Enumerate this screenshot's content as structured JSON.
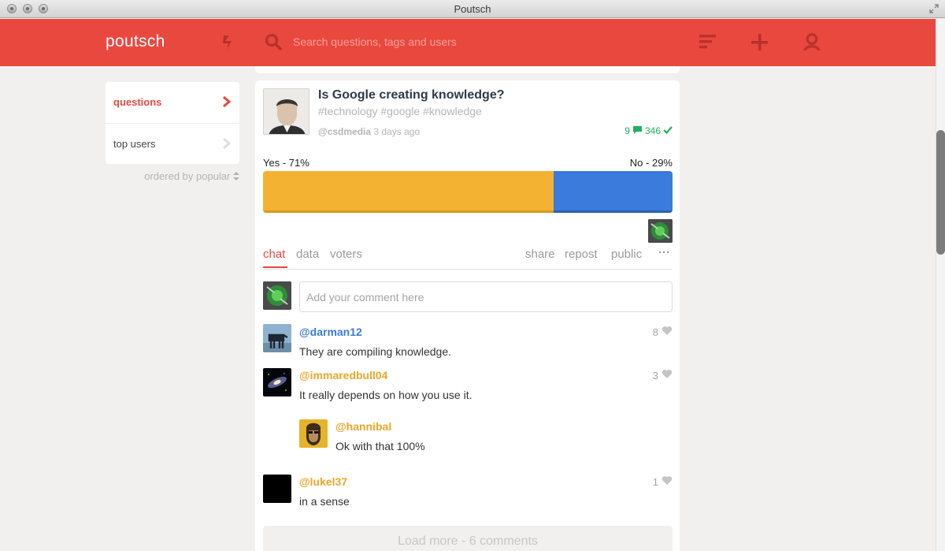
{
  "window": {
    "title": "Poutsch"
  },
  "header": {
    "logo": "poutsch",
    "search_placeholder": "Search questions, tags and users",
    "icons": [
      "bolt-icon",
      "search-icon",
      "menu-icon",
      "plus-icon",
      "user-icon"
    ]
  },
  "sidebar": {
    "items": [
      {
        "label": "questions",
        "active": true
      },
      {
        "label": "top users",
        "active": false
      }
    ],
    "ordered_by": "ordered by popular"
  },
  "question": {
    "title": "Is Google creating knowledge?",
    "tags": "#technology #google #knowledge",
    "author": "@csdmedia",
    "time": "3 days ago",
    "comments_count": "9",
    "votes_count": "346",
    "poll": {
      "yes_label": "Yes - 71%",
      "no_label": "No - 29%",
      "yes_percent": 71,
      "no_percent": 29
    }
  },
  "colors": {
    "brand": "#e9483f",
    "yes": "#f3b232",
    "no": "#3a7bdb",
    "stat": "#22b15f",
    "mention_blue": "#3a7bdb",
    "mention_orange": "#f0a528"
  },
  "tabs": {
    "left": [
      "chat",
      "data",
      "voters"
    ],
    "right": [
      "share",
      "repost",
      "public"
    ],
    "more": "···",
    "active": "chat"
  },
  "comment_box": {
    "placeholder": "Add your comment here"
  },
  "comments": [
    {
      "user": "@darman12",
      "text": "They are compiling knowledge.",
      "likes": "8"
    },
    {
      "user": "@immaredbull04",
      "text": "It really depends on how you use it.",
      "likes": "3"
    },
    {
      "user": "@hannibal",
      "text": "Ok with that 100%"
    },
    {
      "user": "@lukel37",
      "text": "in a sense",
      "likes": "1"
    }
  ],
  "load_more": "Load more - 6 comments"
}
